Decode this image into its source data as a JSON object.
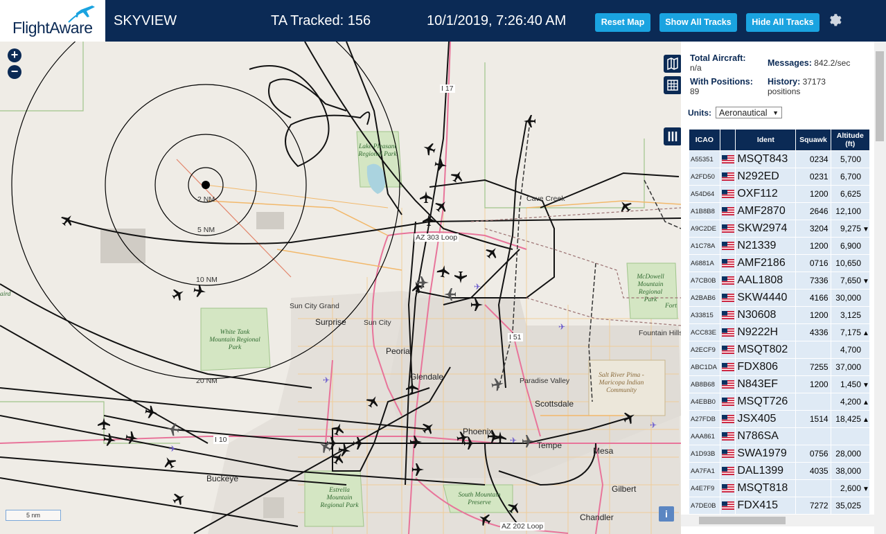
{
  "header": {
    "logo_text": "FlightAware",
    "site_name": "SKYVIEW",
    "ta_tracked": "TA Tracked: 156",
    "datetime": "10/1/2019, 7:26:40 AM",
    "buttons": {
      "reset_map": "Reset Map",
      "show_all_tracks": "Show All Tracks",
      "hide_all_tracks": "Hide All Tracks"
    }
  },
  "map": {
    "zoom_in": "+",
    "zoom_out": "−",
    "range_rings": [
      "2 NM",
      "5 NM",
      "10 NM",
      "20 NM"
    ],
    "places": [
      "Lake Pleasant Regional Park",
      "Cave Creek",
      "AZ 303 Loop",
      "Sun City Grand",
      "Surprise",
      "Sun City",
      "White Tank Mountain Regional Park",
      "Peoria",
      "Glendale",
      "Paradise Valley",
      "Scottsdale",
      "Salt River Pima - Maricopa Indian Community",
      "Phoenix",
      "Tempe",
      "Mesa",
      "Gilbert",
      "Chandler",
      "Buckeye",
      "Estrella Mountain Regional Park",
      "South Mountain Preserve",
      "McDowell Mountain Regional Park",
      "Fountain Hills",
      "Fort",
      "I 10",
      "I 17",
      "I 51",
      "AZ 202 Loop",
      "aird"
    ],
    "scale_label": "5 nm",
    "info_label": "i"
  },
  "panel": {
    "total_aircraft_label": "Total Aircraft:",
    "total_aircraft_value": "n/a",
    "messages_label": "Messages:",
    "messages_value": "842.2/sec",
    "with_positions_label": "With Positions:",
    "with_positions_value": "89",
    "history_label": "History:",
    "history_value": "37173",
    "history_unit": "positions",
    "units_label": "Units:",
    "units_value": "Aeronautical",
    "columns": [
      "ICAO",
      "",
      "Ident",
      "Squawk",
      "Altitude (ft)"
    ],
    "rows": [
      {
        "icao": "A55351",
        "ident": "MSQT843",
        "squawk": "0234",
        "altitude": "5,700",
        "trend": ""
      },
      {
        "icao": "A2FD50",
        "ident": "N292ED",
        "squawk": "0231",
        "altitude": "6,700",
        "trend": ""
      },
      {
        "icao": "A54D64",
        "ident": "OXF112",
        "squawk": "1200",
        "altitude": "6,625",
        "trend": ""
      },
      {
        "icao": "A1B8B8",
        "ident": "AMF2870",
        "squawk": "2646",
        "altitude": "12,100",
        "trend": ""
      },
      {
        "icao": "A9C2DE",
        "ident": "SKW2974",
        "squawk": "3204",
        "altitude": "9,275",
        "trend": "▼"
      },
      {
        "icao": "A1C78A",
        "ident": "N21339",
        "squawk": "1200",
        "altitude": "6,900",
        "trend": ""
      },
      {
        "icao": "A6881A",
        "ident": "AMF2186",
        "squawk": "0716",
        "altitude": "10,650",
        "trend": ""
      },
      {
        "icao": "A7CB0B",
        "ident": "AAL1808",
        "squawk": "7336",
        "altitude": "7,650",
        "trend": "▼"
      },
      {
        "icao": "A2BAB6",
        "ident": "SKW4440",
        "squawk": "4166",
        "altitude": "30,000",
        "trend": ""
      },
      {
        "icao": "A33815",
        "ident": "N30608",
        "squawk": "1200",
        "altitude": "3,125",
        "trend": ""
      },
      {
        "icao": "ACC83E",
        "ident": "N9222H",
        "squawk": "4336",
        "altitude": "7,175",
        "trend": "▲"
      },
      {
        "icao": "A2ECF9",
        "ident": "MSQT802",
        "squawk": "",
        "altitude": "4,700",
        "trend": ""
      },
      {
        "icao": "ABC1DA",
        "ident": "FDX806",
        "squawk": "7255",
        "altitude": "37,000",
        "trend": ""
      },
      {
        "icao": "AB8B68",
        "ident": "N843EF",
        "squawk": "1200",
        "altitude": "1,450",
        "trend": "▼"
      },
      {
        "icao": "A4EBB0",
        "ident": "MSQT726",
        "squawk": "",
        "altitude": "4,200",
        "trend": "▲"
      },
      {
        "icao": "A27FDB",
        "ident": "JSX405",
        "squawk": "1514",
        "altitude": "18,425",
        "trend": "▲"
      },
      {
        "icao": "AAA861",
        "ident": "N786SA",
        "squawk": "",
        "altitude": "",
        "trend": ""
      },
      {
        "icao": "A1D93B",
        "ident": "SWA1979",
        "squawk": "0756",
        "altitude": "28,000",
        "trend": ""
      },
      {
        "icao": "AA7FA1",
        "ident": "DAL1399",
        "squawk": "4035",
        "altitude": "38,000",
        "trend": ""
      },
      {
        "icao": "A4E7F9",
        "ident": "MSQT818",
        "squawk": "",
        "altitude": "2,600",
        "trend": "▼"
      },
      {
        "icao": "A7DE0B",
        "ident": "FDX415",
        "squawk": "7272",
        "altitude": "35,025",
        "trend": ""
      }
    ]
  }
}
